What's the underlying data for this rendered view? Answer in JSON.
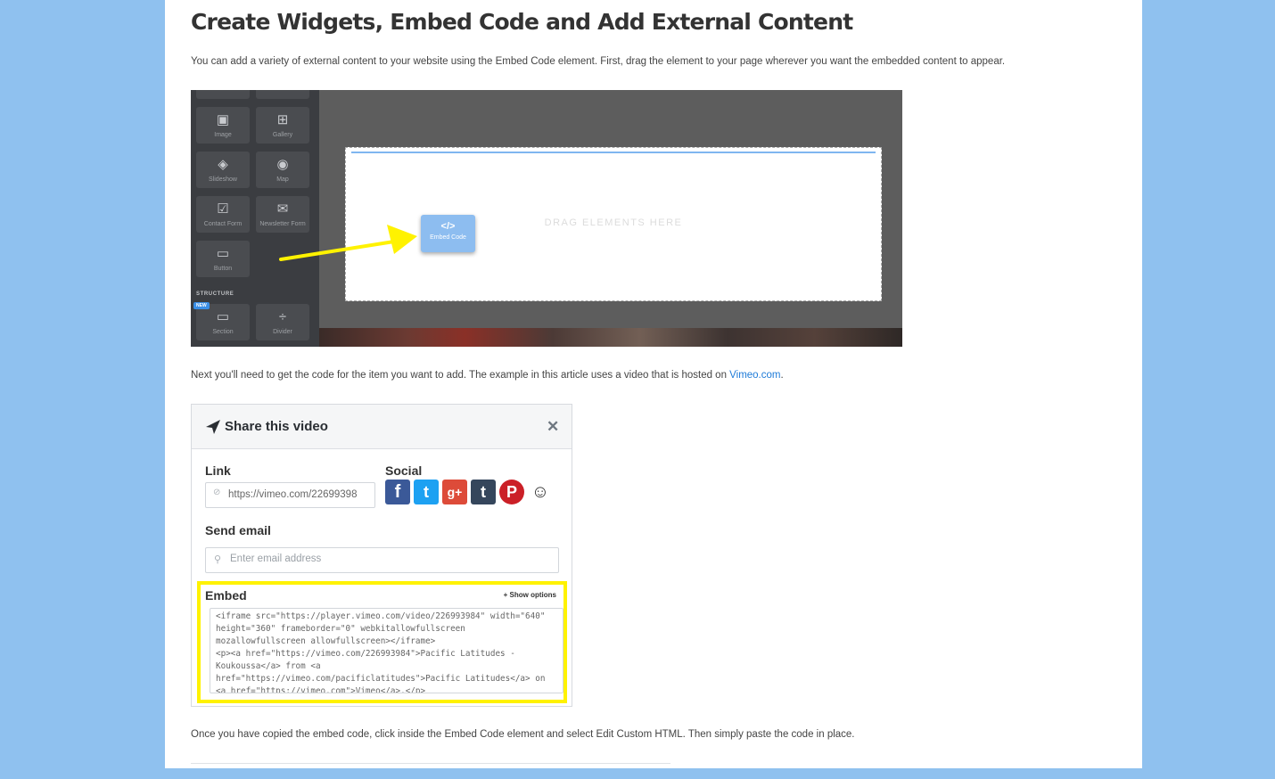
{
  "article": {
    "title": "Create Widgets, Embed Code and Add External Content",
    "intro": "You can add a variety of external content to your website using the Embed Code element. First, drag the element to your page wherever you want the embedded content to appear.",
    "step2_text": "Next you'll need to get the code for the item you want to add. The example in this article uses a video that is hosted on ",
    "step2_link": "Vimeo.com",
    "step2_end": ".",
    "step3_text": "Once you have copied the embed code, click inside the Embed Code element and select Edit Custom HTML. Then simply paste the code in place."
  },
  "editor": {
    "elements": [
      {
        "label": "Image",
        "icon": "image-icon",
        "glyph": "▣"
      },
      {
        "label": "Gallery",
        "icon": "gallery-icon",
        "glyph": "⊞"
      },
      {
        "label": "Slideshow",
        "icon": "slideshow-icon",
        "glyph": "◈"
      },
      {
        "label": "Map",
        "icon": "map-pin-icon",
        "glyph": "◉"
      },
      {
        "label": "Contact Form",
        "icon": "contact-form-icon",
        "glyph": "☑"
      },
      {
        "label": "Newsletter Form",
        "icon": "envelope-icon",
        "glyph": "✉"
      },
      {
        "label": "Button",
        "icon": "button-icon",
        "glyph": "▭"
      }
    ],
    "structure_label": "STRUCTURE",
    "new_badge": "NEW",
    "structure_items": [
      {
        "label": "Section",
        "icon": "section-icon",
        "glyph": "▭"
      },
      {
        "label": "Divider",
        "icon": "divider-icon",
        "glyph": "÷"
      }
    ],
    "dropzone_hint": "DRAG ELEMENTS HERE",
    "embed_tile": {
      "glyph": "</>",
      "label": "Embed Code"
    },
    "arrow_color": "#fff200"
  },
  "share_dialog": {
    "title": "Share this video",
    "close": "✕",
    "link_label": "Link",
    "link_value": "https://vimeo.com/22699398",
    "social_label": "Social",
    "social": [
      {
        "name": "facebook-icon",
        "glyph": "f",
        "color": "#3b5998"
      },
      {
        "name": "twitter-icon",
        "glyph": "t",
        "color": "#1da1f2"
      },
      {
        "name": "google-plus-icon",
        "glyph": "g+",
        "color": "#dd4b39"
      },
      {
        "name": "tumblr-icon",
        "glyph": "t",
        "color": "#35465c"
      },
      {
        "name": "pinterest-icon",
        "glyph": "P",
        "color": "#cb2027"
      },
      {
        "name": "reddit-icon",
        "glyph": "☺",
        "color": "#ffffff"
      }
    ],
    "email_label": "Send email",
    "email_placeholder": "Enter email address",
    "embed_label": "Embed",
    "show_options": "+ Show options",
    "embed_code": [
      "<iframe src=\"https://player.vimeo.com/video/226993984\" width=\"640\"",
      "height=\"360\" frameborder=\"0\" webkitallowfullscreen",
      "mozallowfullscreen allowfullscreen></iframe>",
      "<p><a href=\"https://vimeo.com/226993984\">Pacific Latitudes -",
      "Koukoussa</a> from <a",
      "href=\"https://vimeo.com/pacificlatitudes\">Pacific Latitudes</a> on",
      "<a href=\"https://vimeo.com\">Vimeo</a>.</p>"
    ],
    "highlight_color": "#fff200"
  }
}
